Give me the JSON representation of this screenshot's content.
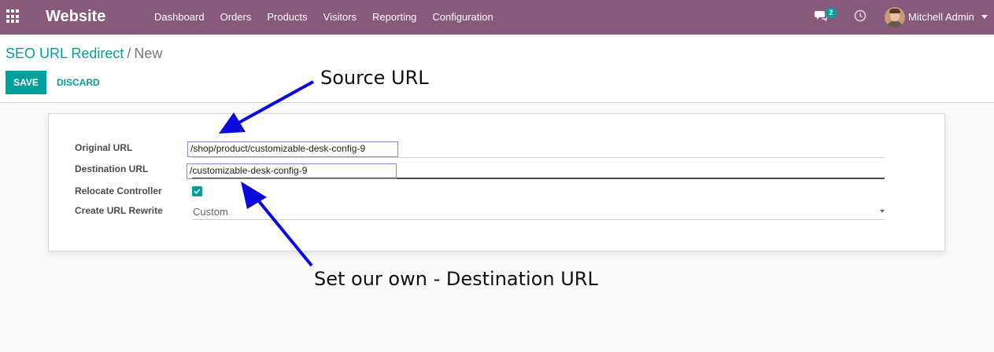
{
  "navbar": {
    "app_name": "Website",
    "menu": [
      "Dashboard",
      "Orders",
      "Products",
      "Visitors",
      "Reporting",
      "Configuration"
    ],
    "chat_count": "2",
    "user_name": "Mitchell Admin",
    "brand_color": "#875a7b"
  },
  "breadcrumb": {
    "parent": "SEO URL Redirect",
    "separator": "/",
    "current": "New"
  },
  "actions": {
    "save": "SAVE",
    "discard": "DISCARD",
    "accent_color": "#00a09d"
  },
  "form": {
    "original_url_label": "Original URL",
    "original_url_value": "/shop/product/customizable-desk-config-9",
    "destination_url_label": "Destination URL",
    "destination_url_value": "/customizable-desk-config-9",
    "relocate_label": "Relocate Controller",
    "relocate_checked": true,
    "rewrite_label": "Create URL Rewrite",
    "rewrite_value": "Custom"
  },
  "annotations": {
    "source": "Source URL",
    "destination": "Set our own - Destination URL",
    "arrow_color": "#0a0adc"
  }
}
